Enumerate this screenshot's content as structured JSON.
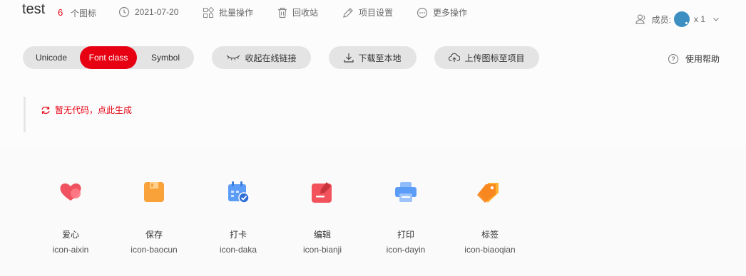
{
  "header": {
    "project_name": "test",
    "icon_count": "6",
    "icon_count_label": "个图标",
    "date": "2021-07-20",
    "batch_ops": "批量操作",
    "recycle_bin": "回收站",
    "project_settings": "项目设置",
    "more_ops": "更多操作",
    "members_label": "成员:",
    "members_count": "x 1"
  },
  "toolbar": {
    "tabs": [
      "Unicode",
      "Font class",
      "Symbol"
    ],
    "active_tab": "Font class",
    "collapse_link": "收起在线链接",
    "download": "下载至本地",
    "upload": "上传图标至项目",
    "help": "使用帮助"
  },
  "code_area": {
    "empty_text": "暂无代码，点此生成"
  },
  "icons": [
    {
      "name": "爱心",
      "class": "icon-aixin"
    },
    {
      "name": "保存",
      "class": "icon-baocun"
    },
    {
      "name": "打卡",
      "class": "icon-daka"
    },
    {
      "name": "编辑",
      "class": "icon-bianji"
    },
    {
      "name": "打印",
      "class": "icon-dayin"
    },
    {
      "name": "标签",
      "class": "icon-biaoqian"
    }
  ],
  "colors": {
    "accent": "#e60012",
    "pill_bg": "#e4e4e4"
  }
}
